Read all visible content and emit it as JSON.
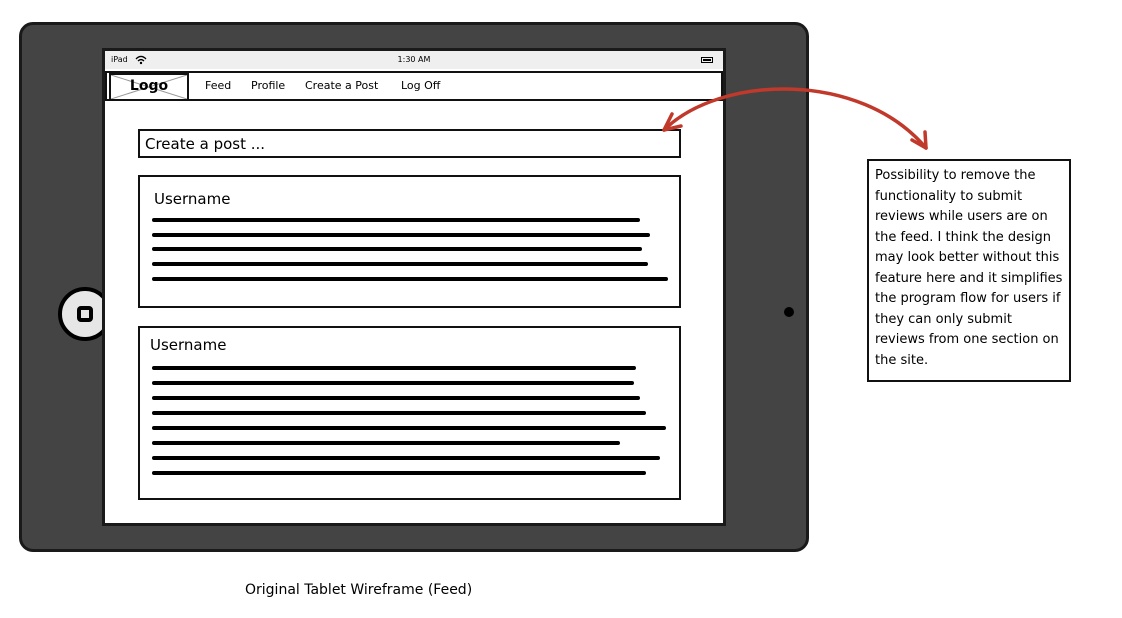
{
  "device": {
    "status_bar": {
      "carrier": "iPad",
      "time": "1:30 AM"
    }
  },
  "nav": {
    "logo": "Logo",
    "links": [
      "Feed",
      "Profile",
      "Create a Post",
      "Log Off"
    ]
  },
  "create_post": {
    "placeholder": "Create a post ..."
  },
  "posts": [
    {
      "username": "Username"
    },
    {
      "username": "Username"
    }
  ],
  "annotation": {
    "text": "Possibility to remove the functionality to submit reviews while users are on the feed. I think the design may look better without this feature here and it simplifies the program flow for users if they can only submit reviews from one section on the site."
  },
  "caption": "Original Tablet Wireframe (Feed)",
  "colors": {
    "device_frame": "#444444",
    "arrow": "#c0392b"
  }
}
